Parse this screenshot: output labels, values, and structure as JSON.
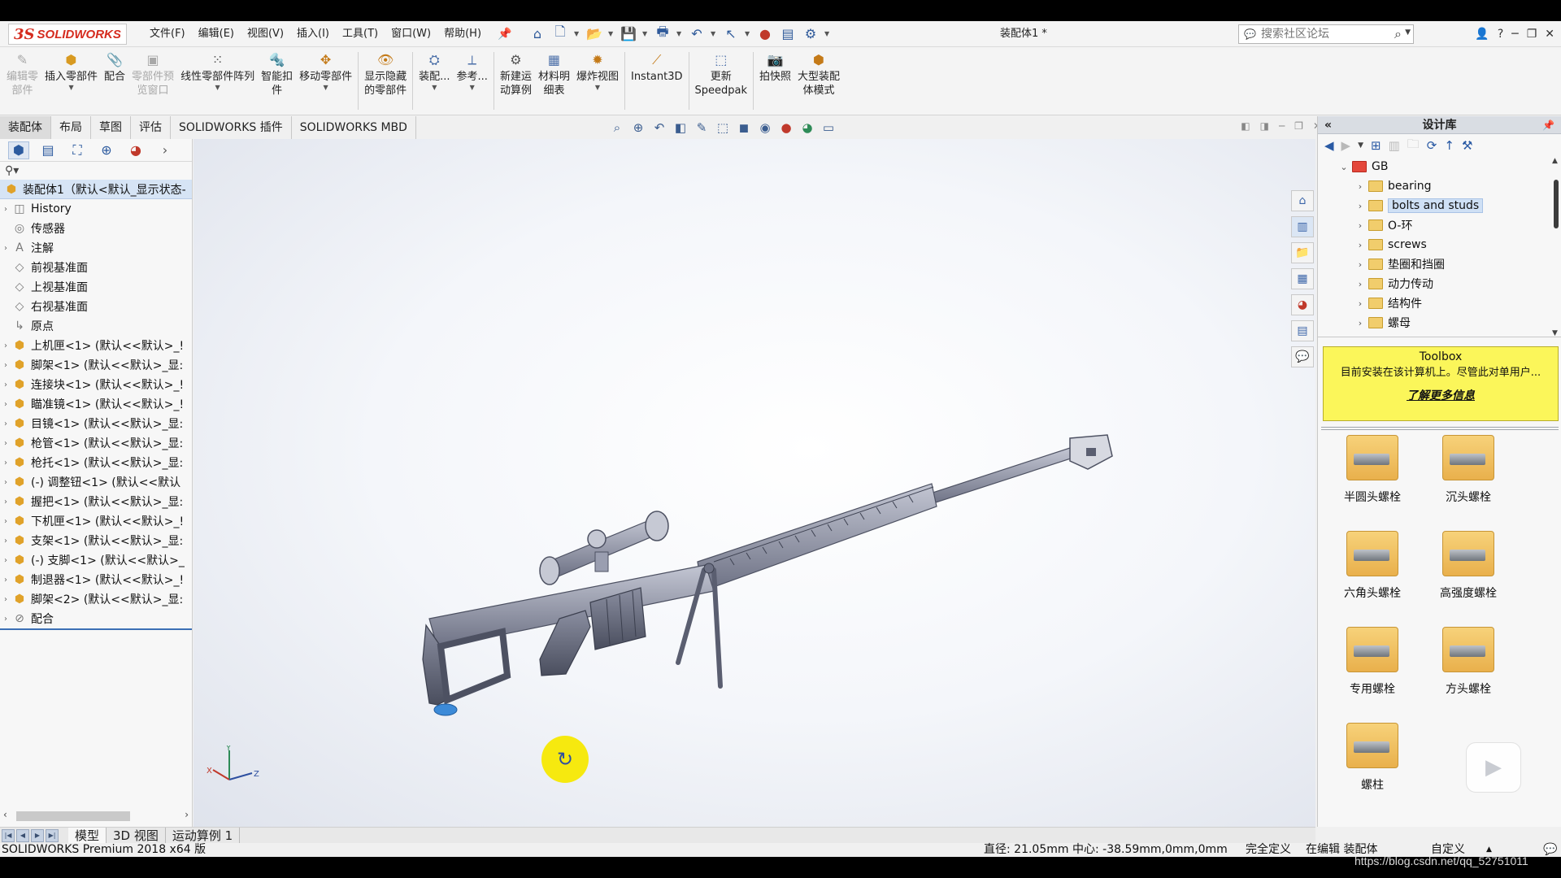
{
  "app": {
    "logo_ds": "3S",
    "logo_word": "SOLIDWORKS",
    "document_title": "装配体1 *",
    "brand_color": "#d52b1e"
  },
  "menus": [
    "文件(F)",
    "编辑(E)",
    "视图(V)",
    "插入(I)",
    "工具(T)",
    "窗口(W)",
    "帮助(H)"
  ],
  "search": {
    "placeholder": "搜索社区论坛"
  },
  "commands": [
    {
      "label": "编辑零\n部件",
      "icon": "edit-component-icon",
      "enabled": false
    },
    {
      "label": "插入零部件",
      "icon": "insert-component-icon",
      "enabled": true,
      "dropdown": true
    },
    {
      "label": "配合",
      "icon": "mate-icon",
      "enabled": true
    },
    {
      "label": "零部件预\n览窗口",
      "icon": "component-preview-icon",
      "enabled": false
    },
    {
      "label": "线性零部件阵列",
      "icon": "linear-pattern-icon",
      "enabled": true,
      "dropdown": true
    },
    {
      "label": "智能扣\n件",
      "icon": "smart-fasteners-icon",
      "enabled": true
    },
    {
      "label": "移动零部件",
      "icon": "move-component-icon",
      "enabled": true,
      "dropdown": true
    },
    {
      "label": "显示隐藏\n的零部件",
      "icon": "show-hidden-icon",
      "enabled": true
    },
    {
      "label": "装配...",
      "icon": "assembly-features-icon",
      "enabled": true,
      "dropdown": true
    },
    {
      "label": "参考...",
      "icon": "reference-geometry-icon",
      "enabled": true,
      "dropdown": true
    },
    {
      "label": "新建运\n动算例",
      "icon": "new-motion-study-icon",
      "enabled": true
    },
    {
      "label": "材料明\n细表",
      "icon": "bill-of-materials-icon",
      "enabled": true
    },
    {
      "label": "爆炸视图",
      "icon": "exploded-view-icon",
      "enabled": true,
      "dropdown": true
    },
    {
      "label": "Instant3D",
      "icon": "instant3d-icon",
      "enabled": true
    },
    {
      "label": "更新\nSpeedpak",
      "icon": "speedpak-icon",
      "enabled": true
    },
    {
      "label": "拍快照",
      "icon": "snapshot-icon",
      "enabled": true
    },
    {
      "label": "大型装配\n体模式",
      "icon": "large-assembly-icon",
      "enabled": true
    }
  ],
  "command_tabs": [
    "装配体",
    "布局",
    "草图",
    "评估",
    "SOLIDWORKS 插件",
    "SOLIDWORKS MBD"
  ],
  "feature_tree": {
    "root": "装配体1（默认<默认_显示状态-",
    "items": [
      {
        "label": "History",
        "icon": "history-icon",
        "expandable": true
      },
      {
        "label": "传感器",
        "icon": "sensor-icon",
        "expandable": false
      },
      {
        "label": "注解",
        "icon": "annotation-icon",
        "expandable": true
      },
      {
        "label": "前视基准面",
        "icon": "plane-icon",
        "expandable": false
      },
      {
        "label": "上视基准面",
        "icon": "plane-icon",
        "expandable": false
      },
      {
        "label": "右视基准面",
        "icon": "plane-icon",
        "expandable": false
      },
      {
        "label": "原点",
        "icon": "origin-icon",
        "expandable": false
      },
      {
        "label": "上机匣<1> (默认<<默认>_!",
        "icon": "part-icon",
        "expandable": true
      },
      {
        "label": "脚架<1> (默认<<默认>_显:",
        "icon": "part-icon",
        "expandable": true
      },
      {
        "label": "连接块<1> (默认<<默认>_!",
        "icon": "part-icon",
        "expandable": true
      },
      {
        "label": "瞄准镜<1> (默认<<默认>_!",
        "icon": "part-icon",
        "expandable": true
      },
      {
        "label": "目镜<1> (默认<<默认>_显:",
        "icon": "part-icon",
        "expandable": true
      },
      {
        "label": "枪管<1> (默认<<默认>_显:",
        "icon": "part-icon",
        "expandable": true
      },
      {
        "label": "枪托<1> (默认<<默认>_显:",
        "icon": "part-icon",
        "expandable": true
      },
      {
        "label": "(-) 调整钮<1> (默认<<默认",
        "icon": "part-icon",
        "expandable": true
      },
      {
        "label": "握把<1> (默认<<默认>_显:",
        "icon": "part-icon",
        "expandable": true
      },
      {
        "label": "下机匣<1> (默认<<默认>_!",
        "icon": "part-icon",
        "expandable": true
      },
      {
        "label": "支架<1> (默认<<默认>_显:",
        "icon": "part-icon",
        "expandable": true
      },
      {
        "label": "(-) 支脚<1> (默认<<默认>_",
        "icon": "part-icon",
        "expandable": true
      },
      {
        "label": "制退器<1> (默认<<默认>_!",
        "icon": "part-icon",
        "expandable": true
      },
      {
        "label": "脚架<2> (默认<<默认>_显:",
        "icon": "part-icon",
        "expandable": true
      },
      {
        "label": "配合",
        "icon": "mates-folder-icon",
        "expandable": true
      }
    ]
  },
  "design_library": {
    "title": "设计库",
    "tree": [
      {
        "label": "GB",
        "level": 0,
        "expanded": true,
        "folder_color": "red"
      },
      {
        "label": "bearing",
        "level": 1
      },
      {
        "label": "bolts and studs",
        "level": 1,
        "selected": true
      },
      {
        "label": "O-环",
        "level": 1
      },
      {
        "label": "screws",
        "level": 1
      },
      {
        "label": "垫圈和挡圈",
        "level": 1
      },
      {
        "label": "动力传动",
        "level": 1
      },
      {
        "label": "结构件",
        "level": 1
      },
      {
        "label": "螺母",
        "level": 1
      }
    ],
    "toolbox": {
      "title": "Toolbox",
      "message": "目前安装在该计算机上。尽管此对单用户...",
      "link": "了解更多信息"
    },
    "items": [
      "半圆头螺栓",
      "沉头螺栓",
      "六角头螺栓",
      "高强度螺栓",
      "专用螺栓",
      "方头螺栓",
      "螺柱"
    ]
  },
  "bottom_tabs": [
    "模型",
    "3D 视图",
    "运动算例 1"
  ],
  "status": {
    "product": "SOLIDWORKS Premium 2018 x64 版",
    "measure": "直径: 21.05mm  中心: -38.59mm,0mm,0mm",
    "definition": "完全定义",
    "editing": "在编辑 装配体",
    "units": "自定义"
  },
  "watermark": "https://blog.csdn.net/qq_52751011"
}
